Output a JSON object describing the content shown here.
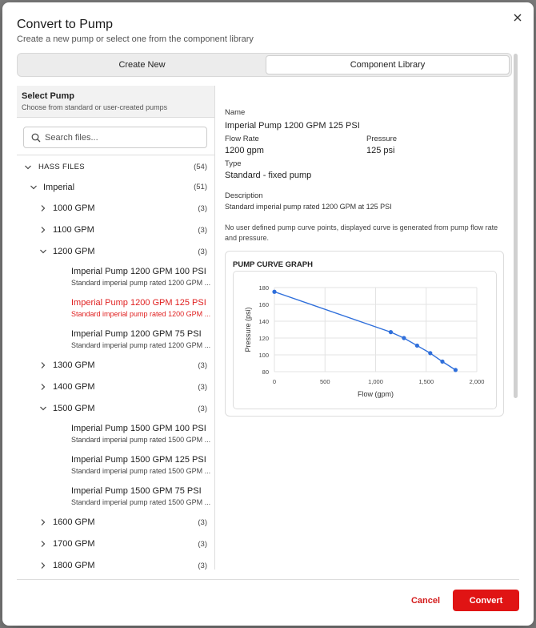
{
  "dialog": {
    "title": "Convert to Pump",
    "subtitle": "Create a new pump or select one from the component library"
  },
  "tabs": [
    {
      "label": "Create New",
      "active": false
    },
    {
      "label": "Component Library",
      "active": true
    }
  ],
  "left_panel": {
    "heading": "Select Pump",
    "subheading": "Choose from standard or user-created pumps",
    "search_placeholder": "Search files...",
    "tree": {
      "root": {
        "label": "HASS FILES",
        "count": "(54)"
      },
      "group": {
        "label": "Imperial",
        "count": "(51)"
      },
      "folders": [
        {
          "label": "1000 GPM",
          "count": "(3)"
        },
        {
          "label": "1100 GPM",
          "count": "(3)"
        },
        {
          "label": "1200 GPM",
          "count": "(3)"
        },
        {
          "label": "1300 GPM",
          "count": "(3)"
        },
        {
          "label": "1400 GPM",
          "count": "(3)"
        },
        {
          "label": "1500 GPM",
          "count": "(3)"
        },
        {
          "label": "1600 GPM",
          "count": "(3)"
        },
        {
          "label": "1700 GPM",
          "count": "(3)"
        },
        {
          "label": "1800 GPM",
          "count": "(3)"
        }
      ],
      "items_1200": [
        {
          "name": "Imperial Pump 1200 GPM 100 PSI",
          "desc": "Standard imperial pump rated 1200 GPM ..."
        },
        {
          "name": "Imperial Pump 1200 GPM 125 PSI",
          "desc": "Standard imperial pump rated 1200 GPM ..."
        },
        {
          "name": "Imperial Pump 1200 GPM 75 PSI",
          "desc": "Standard imperial pump rated 1200 GPM ..."
        }
      ],
      "items_1500": [
        {
          "name": "Imperial Pump 1500 GPM 100 PSI",
          "desc": "Standard imperial pump rated 1500 GPM ..."
        },
        {
          "name": "Imperial Pump 1500 GPM 125 PSI",
          "desc": "Standard imperial pump rated 1500 GPM ..."
        },
        {
          "name": "Imperial Pump 1500 GPM 75 PSI",
          "desc": "Standard imperial pump rated 1500 GPM ..."
        }
      ]
    }
  },
  "details": {
    "name_label": "Name",
    "name_value": "Imperial Pump 1200 GPM 125 PSI",
    "flow_label": "Flow Rate",
    "flow_value": "1200 gpm",
    "pressure_label": "Pressure",
    "pressure_value": "125 psi",
    "type_label": "Type",
    "type_value": "Standard - fixed pump",
    "description_label": "Description",
    "description_value": "Standard imperial pump rated 1200 GPM at 125 PSI",
    "note": "No user defined pump curve points, displayed curve is generated from pump flow rate and pressure.",
    "graph_title": "PUMP CURVE GRAPH"
  },
  "chart_data": {
    "type": "line",
    "title": "",
    "xlabel": "Flow (gpm)",
    "ylabel": "Pressure (psi)",
    "xlim": [
      0,
      2000
    ],
    "ylim": [
      80,
      180
    ],
    "x_ticks": [
      "0",
      "500",
      "1,000",
      "1,500",
      "2,000"
    ],
    "y_ticks": [
      "80",
      "100",
      "120",
      "140",
      "160",
      "180"
    ],
    "grid": true,
    "series": [
      {
        "color": "#2f6fdb",
        "points": [
          [
            0,
            175
          ],
          [
            1150,
            127
          ],
          [
            1280,
            120
          ],
          [
            1410,
            111
          ],
          [
            1540,
            102
          ],
          [
            1660,
            92
          ],
          [
            1790,
            82
          ]
        ]
      }
    ]
  },
  "footer": {
    "cancel_label": "Cancel",
    "convert_label": "Convert"
  },
  "colors": {
    "accent": "#e01414",
    "selected_text": "#e02020",
    "line": "#2f6fdb"
  }
}
